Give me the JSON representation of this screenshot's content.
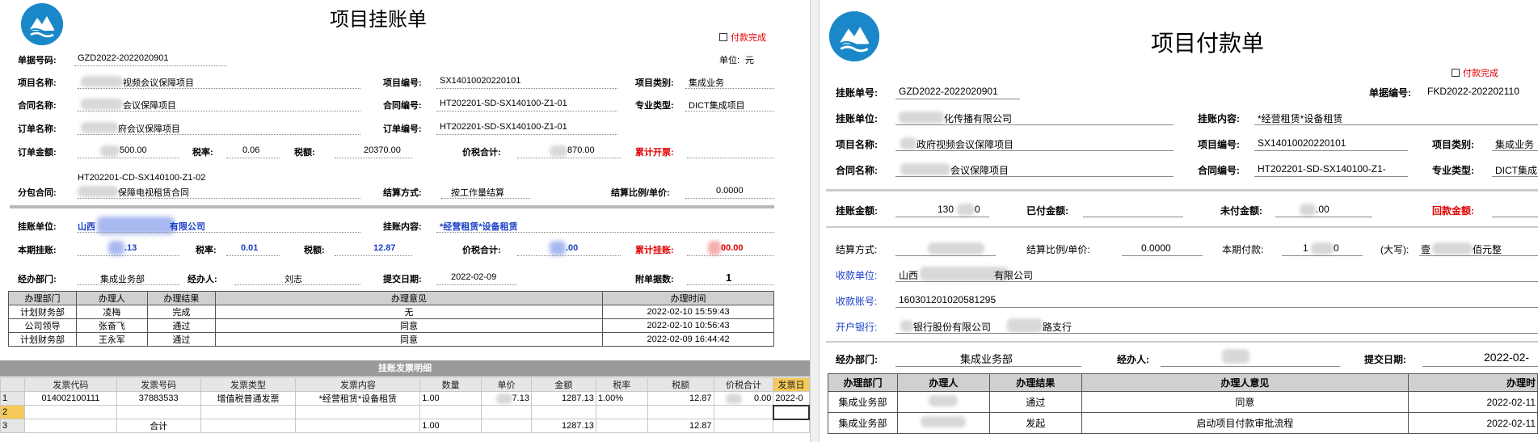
{
  "left": {
    "title": "项目挂账单",
    "done_label": "付款完成",
    "doc_no_label": "单据号码:",
    "doc_no": "GZD2022-2022020901",
    "unit_label": "单位:",
    "unit": "元",
    "fields": {
      "project_name_label": "项目名称:",
      "project_name": "视频会议保障项目",
      "project_no_label": "项目编号:",
      "project_no": "SX14010020220101",
      "project_type_label": "项目类别:",
      "project_type": "集成业务",
      "contract_name_label": "合同名称:",
      "contract_name": "会议保障项目",
      "contract_no_label": "合同编号:",
      "contract_no": "HT202201-SD-SX140100-Z1-01",
      "major_label": "专业类型:",
      "major": "DICT集成项目",
      "order_name_label": "订单名称:",
      "order_name": "府会议保障项目",
      "order_no_label": "订单编号:",
      "order_no": "HT202201-SD-SX140100-Z1-01",
      "order_amount_label": "订单金额:",
      "order_amount": "500.00",
      "tax_rate_label": "税率:",
      "tax_rate": "0.06",
      "tax_label": "税额:",
      "tax": "20370.00",
      "total_label": "价税合计:",
      "total": "870.00",
      "accum_invoice_label": "累计开票:",
      "sub_contract_label": "分包合同:",
      "sub_contract_no": "HT202201-CD-SX140100-Z1-02",
      "sub_contract_name": "保障电视租赁合同",
      "settle_label": "结算方式:",
      "settle": "按工作量结算",
      "ratio_label": "结算比例/单价:",
      "ratio": "0.0000",
      "acc_unit_label": "挂账单位:",
      "acc_unit_a": "山西",
      "acc_unit_b": "有限公司",
      "acc_content_label": "挂账内容:",
      "acc_content": "*经营租赁*设备租赁",
      "cur_acc_label": "本期挂账:",
      "cur_acc": ".13",
      "tax_rate2_label": "税率:",
      "tax_rate2": "0.01",
      "tax2_label": "税额:",
      "tax2": "12.87",
      "total2_label": "价税合计:",
      "total2": ".00",
      "accum_acc_label": "累计挂账:",
      "accum_acc": "00.00",
      "dept_label": "经办部门:",
      "dept": "集成业务部",
      "handler_label": "经办人:",
      "handler": "刘志",
      "submit_label": "提交日期:",
      "submit": "2022-02-09",
      "attach_label": "附单据数:",
      "attach": "1"
    },
    "approval": {
      "headers": [
        "办理部门",
        "办理人",
        "办理结果",
        "办理意见",
        "办理时间"
      ],
      "rows": [
        [
          "计划财务部",
          "凌梅",
          "完成",
          "无",
          "2022-02-10 15:59:43"
        ],
        [
          "公司领导",
          "张奋飞",
          "通过",
          "同意",
          "2022-02-10 10:56:43"
        ],
        [
          "计划财务部",
          "王永军",
          "通过",
          "同意",
          "2022-02-09 16:44:42"
        ]
      ]
    },
    "invoice": {
      "title": "挂账发票明细",
      "headers": [
        "",
        "发票代码",
        "发票号码",
        "发票类型",
        "发票内容",
        "数量",
        "单价",
        "金额",
        "税率",
        "税额",
        "价税合计",
        "发票日"
      ],
      "rows": [
        [
          "1",
          "014002100111",
          "37883533",
          "增值税普通发票",
          "*经营租赁*设备租赁",
          "1.00",
          "7.13",
          "1287.13",
          "1.00%",
          "12.87",
          "0.00",
          "2022-0"
        ],
        [
          "2",
          "",
          "",
          "",
          "",
          "",
          "",
          "",
          "",
          "",
          "",
          ""
        ],
        [
          "3",
          "",
          "合计",
          "",
          "",
          "1.00",
          "",
          "1287.13",
          "",
          "12.87",
          "",
          ""
        ]
      ]
    }
  },
  "right": {
    "title": "项目付款单",
    "done_label": "付款完成",
    "fields": {
      "acc_no_label": "挂账单号:",
      "acc_no": "GZD2022-2022020901",
      "doc_no_label": "单据编号:",
      "doc_no": "FKD2022-202202110",
      "acc_unit_label": "挂账单位:",
      "acc_unit": "化传播有限公司",
      "acc_content_label": "挂账内容:",
      "acc_content": "*经营租赁*设备租赁",
      "project_name_label": "项目名称:",
      "project_name": "政府视频会议保障项目",
      "project_no_label": "项目编号:",
      "project_no": "SX14010020220101",
      "project_type_label": "项目类别:",
      "project_type": "集成业务",
      "contract_name_label": "合同名称:",
      "contract_name": "会议保障项目",
      "contract_no_label": "合同编号:",
      "contract_no": "HT202201-SD-SX140100-Z1-",
      "major_label": "专业类型:",
      "major": "DICT集成",
      "acc_amount_label": "挂账金额:",
      "acc_amount_a": "130",
      "acc_amount_b": "0",
      "paid_label": "已付金额:",
      "unpaid_label": "未付金额:",
      "unpaid": ".00",
      "refund_label": "回款金额:",
      "settle_label": "结算方式:",
      "ratio_label": "结算比例/单价:",
      "ratio": "0.0000",
      "cur_pay_label": "本期付款:",
      "cur_pay_a": "1",
      "cur_pay_b": "0",
      "upper_label": "(大写):",
      "upper_a": "壹",
      "upper_b": "佰元整",
      "recv_unit_label": "收款单位:",
      "recv_unit_a": "山西",
      "recv_unit_b": "有限公司",
      "recv_acct_label": "收款账号:",
      "recv_acct": "160301201020581295",
      "bank_label": "开户银行:",
      "bank_a": "银行股份有限公司",
      "bank_b": "路支行",
      "dept_label": "经办部门:",
      "dept": "集成业务部",
      "handler_label": "经办人:",
      "submit_label": "提交日期:",
      "submit": "2022-02-"
    },
    "approval": {
      "headers": [
        "办理部门",
        "办理人",
        "办理结果",
        "办理人意见",
        "办理时"
      ],
      "rows": [
        [
          "集成业务部",
          "",
          "通过",
          "同意",
          "2022-02-11"
        ],
        [
          "集成业务部",
          "",
          "发起",
          "启动项目付款审批流程",
          "2022-02-11"
        ]
      ]
    }
  }
}
